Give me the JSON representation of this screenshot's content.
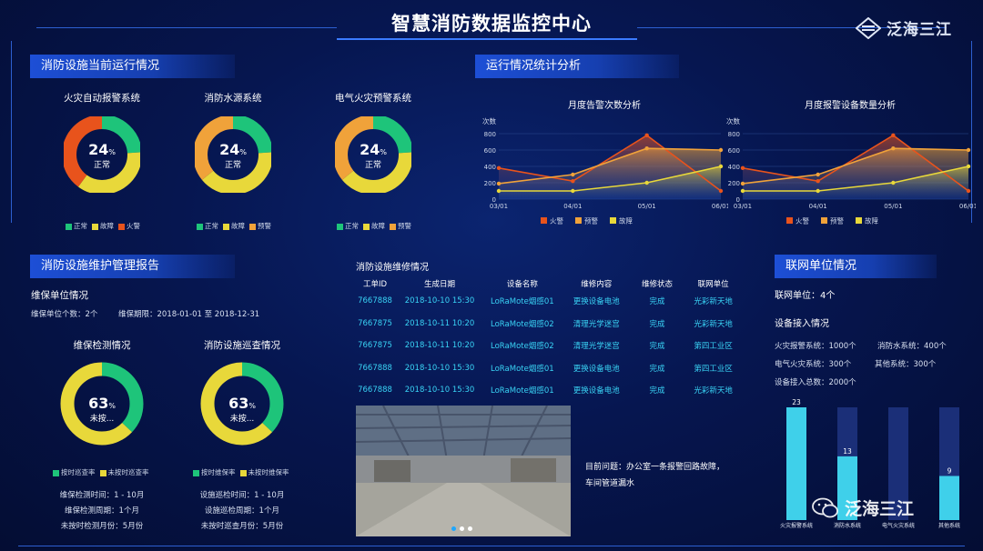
{
  "header": {
    "title": "智慧消防数据监控中心",
    "logo_text": "泛海三江"
  },
  "status_section": {
    "heading": "消防设施当前运行情况",
    "donuts": [
      {
        "title": "火灾自动报警系统",
        "percent": "24",
        "unit": "%",
        "status": "正常",
        "legend": [
          "正常",
          "故障",
          "火警"
        ],
        "colors": [
          "#1ec47a",
          "#e8d83a",
          "#e8531c"
        ],
        "segments": [
          0.24,
          0.36,
          0.4
        ]
      },
      {
        "title": "消防水源系统",
        "percent": "24",
        "unit": "%",
        "status": "正常",
        "legend": [
          "正常",
          "故障",
          "预警"
        ],
        "colors": [
          "#1ec47a",
          "#e8d83a",
          "#f0a23a"
        ],
        "segments": [
          0.24,
          0.4,
          0.36
        ]
      },
      {
        "title": "电气火灾预警系统",
        "percent": "24",
        "unit": "%",
        "status": "正常",
        "legend": [
          "正常",
          "故障",
          "预警"
        ],
        "colors": [
          "#1ec47a",
          "#e8d83a",
          "#f0a23a"
        ],
        "segments": [
          0.24,
          0.4,
          0.36
        ]
      }
    ]
  },
  "stats_section": {
    "heading": "运行情况统计分析"
  },
  "chart_data": [
    {
      "type": "area",
      "title": "月度告警次数分析",
      "ylabel": "次数",
      "x": [
        "03/01",
        "04/01",
        "05/01",
        "06/01"
      ],
      "yticks": [
        "0",
        "200",
        "400",
        "600",
        "800"
      ],
      "ylim": [
        0,
        800
      ],
      "grid": true,
      "legend_position": "bottom",
      "series": [
        {
          "name": "火警",
          "color": "#e8531c",
          "values": [
            380,
            220,
            780,
            100
          ]
        },
        {
          "name": "预警",
          "color": "#f0a23a",
          "values": [
            190,
            300,
            620,
            600
          ]
        },
        {
          "name": "故障",
          "color": "#e8d83a",
          "values": [
            100,
            100,
            200,
            400
          ]
        }
      ]
    },
    {
      "type": "area",
      "title": "月度报警设备数量分析",
      "ylabel": "次数",
      "x": [
        "03/01",
        "04/01",
        "05/01",
        "06/01"
      ],
      "yticks": [
        "0",
        "200",
        "400",
        "600",
        "800"
      ],
      "ylim": [
        0,
        800
      ],
      "grid": true,
      "legend_position": "bottom",
      "series": [
        {
          "name": "火警",
          "color": "#e8531c",
          "values": [
            380,
            220,
            780,
            100
          ]
        },
        {
          "name": "预警",
          "color": "#f0a23a",
          "values": [
            190,
            300,
            620,
            600
          ]
        },
        {
          "name": "故障",
          "color": "#e8d83a",
          "values": [
            100,
            100,
            200,
            400
          ]
        }
      ]
    }
  ],
  "maintenance_section": {
    "heading": "消防设施维护管理报告",
    "unit_heading": "维保单位情况",
    "unit_count": "维保单位个数：2个",
    "unit_period": "维保期限：2018-01-01 至 2018-12-31",
    "donuts": [
      {
        "title": "维保检测情况",
        "percent": "63",
        "unit": "%",
        "status": "未按...",
        "legend": [
          "按时巡查率",
          "未按时巡查率"
        ],
        "colors": [
          "#1ec47a",
          "#e8d83a"
        ],
        "segments": [
          0.37,
          0.63
        ],
        "info": [
          "维保检测时间：1 - 10月",
          "维保检测周期：1个月",
          "未按时检测月份：5月份"
        ]
      },
      {
        "title": "消防设施巡查情况",
        "percent": "63",
        "unit": "%",
        "status": "未按...",
        "legend": [
          "按时维保率",
          "未按时维保率"
        ],
        "colors": [
          "#1ec47a",
          "#e8d83a"
        ],
        "segments": [
          0.37,
          0.63
        ],
        "info": [
          "设施巡检时间：1 - 10月",
          "设施巡检周期：1个月",
          "未按时巡查月份：5月份"
        ]
      }
    ]
  },
  "repair_section": {
    "heading": "消防设施维修情况",
    "columns": [
      "工单ID",
      "生成日期",
      "设备名称",
      "维修内容",
      "维修状态",
      "联网单位"
    ],
    "rows": [
      [
        "7667888",
        "2018-10-10 15:30",
        "LoRaMote烟感01",
        "更换设备电池",
        "完成",
        "光彩新天地"
      ],
      [
        "7667875",
        "2018-10-11 10:20",
        "LoRaMote烟感02",
        "清理光学迷宫",
        "完成",
        "光彩新天地"
      ],
      [
        "7667875",
        "2018-10-11 10:20",
        "LoRaMote烟感02",
        "清理光学迷宫",
        "完成",
        "第四工业区"
      ],
      [
        "7667888",
        "2018-10-10 15:30",
        "LoRaMote烟感01",
        "更换设备电池",
        "完成",
        "第四工业区"
      ],
      [
        "7667888",
        "2018-10-10 15:30",
        "LoRaMote烟感01",
        "更换设备电池",
        "完成",
        "光彩新天地"
      ]
    ],
    "problem_line1": "目前问题：办公室一条报警回路故障，",
    "problem_line2": "车间管道漏水"
  },
  "network_section": {
    "heading": "联网单位情况",
    "unit_count": "联网单位：4个",
    "access_heading": "设备接入情况",
    "stats": [
      "火灾报警系统：1000个",
      "消防水系统：400个",
      "电气火灾系统：300个",
      "其他系统：300个",
      "设备接入总数：2000个"
    ],
    "bars": [
      {
        "label": "火灾报警系统",
        "value": 23,
        "value_text": "23"
      },
      {
        "label": "消防水系统",
        "value": 13,
        "value_text": "13"
      },
      {
        "label": "电气火灾系统",
        "value": 0,
        "value_text": ""
      },
      {
        "label": "其他系统",
        "value": 9,
        "value_text": "9"
      }
    ],
    "bar_max": 23
  },
  "watermark": "泛海三江"
}
